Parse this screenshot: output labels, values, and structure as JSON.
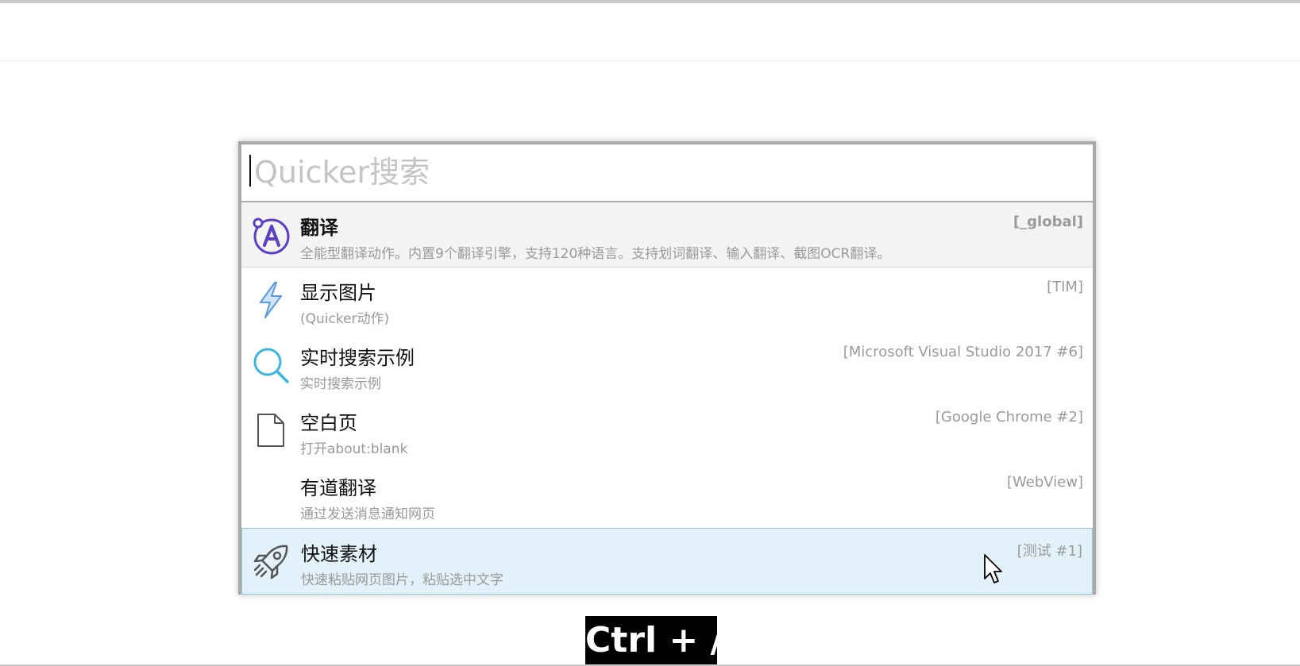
{
  "search": {
    "placeholder": "Quicker搜索",
    "value": ""
  },
  "results": [
    {
      "title": "翻译",
      "subtitle": "全能型翻译动作。内置9个翻译引擎，支持120种语言。支持划词翻译、输入翻译、截图OCR翻译。",
      "tag": "[_global]",
      "icon": "translate-a-icon",
      "state": "selected"
    },
    {
      "title": "显示图片",
      "subtitle": "(Quicker动作)",
      "tag": "[TIM]",
      "icon": "lightning-icon",
      "state": "normal"
    },
    {
      "title": "实时搜索示例",
      "subtitle": "实时搜索示例",
      "tag": "[Microsoft Visual Studio 2017 #6]",
      "icon": "search-icon",
      "state": "normal"
    },
    {
      "title": "空白页",
      "subtitle": "打开about:blank",
      "tag": "[Google Chrome #2]",
      "icon": "blank-page-icon",
      "state": "normal"
    },
    {
      "title": "有道翻译",
      "subtitle": "通过发送消息通知网页",
      "tag": "[WebView]",
      "icon": "",
      "state": "normal"
    },
    {
      "title": "快速素材",
      "subtitle": "快速粘贴网页图片，粘贴选中文字",
      "tag": "[测试 #1]",
      "icon": "rocket-icon",
      "state": "hover"
    }
  ],
  "shortcut": "Ctrl + /",
  "colors": {
    "translate_icon": "#5b3fc4",
    "lightning_icon": "#5a9be0",
    "search_icon": "#3ab5e0",
    "hover_bg": "#e3f2fa",
    "hover_border": "#8ecae6",
    "selected_bg": "#f4f4f4"
  }
}
